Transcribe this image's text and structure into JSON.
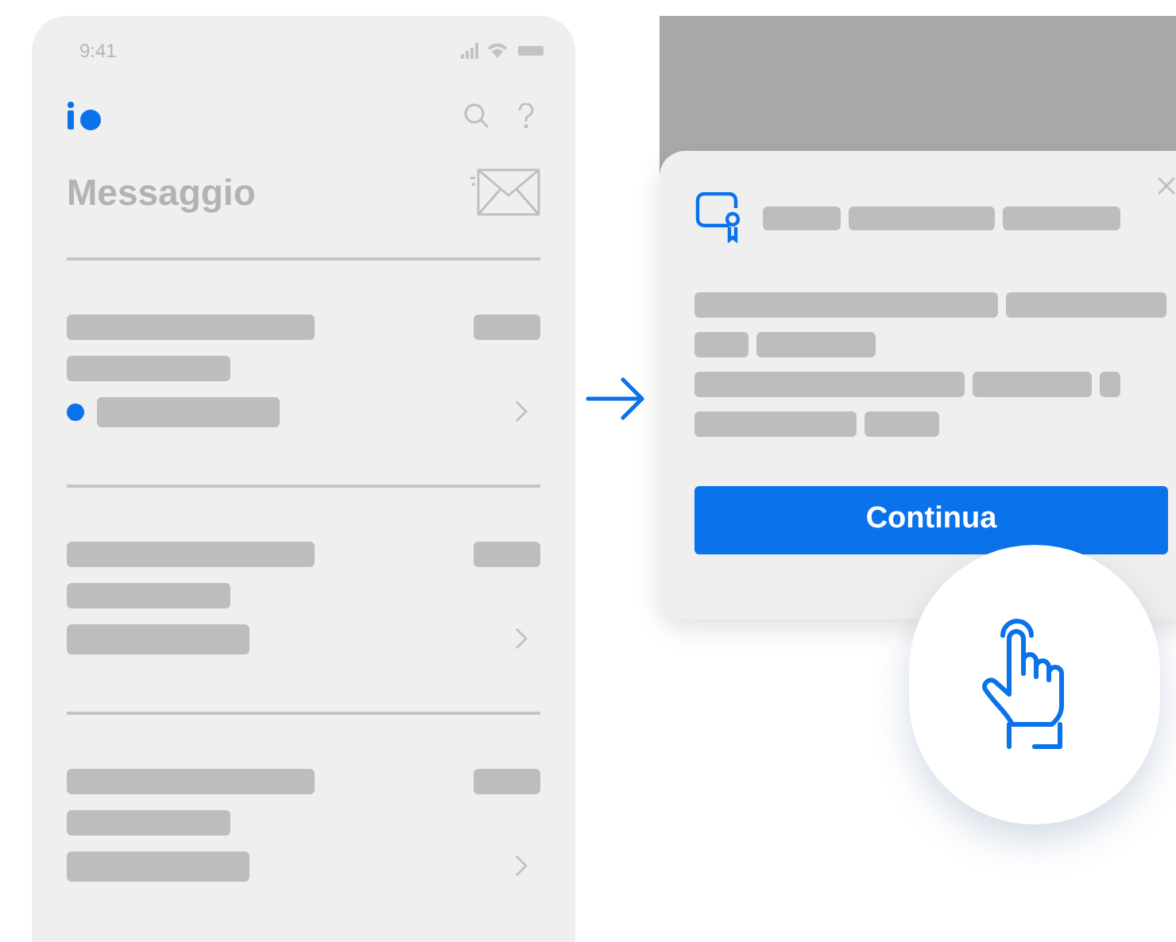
{
  "phone": {
    "status_time": "9:41",
    "title": "Messaggio",
    "messages": [
      {
        "unread": true
      },
      {
        "unread": false
      },
      {
        "unread": false
      }
    ]
  },
  "dialog": {
    "button": "Continua"
  }
}
